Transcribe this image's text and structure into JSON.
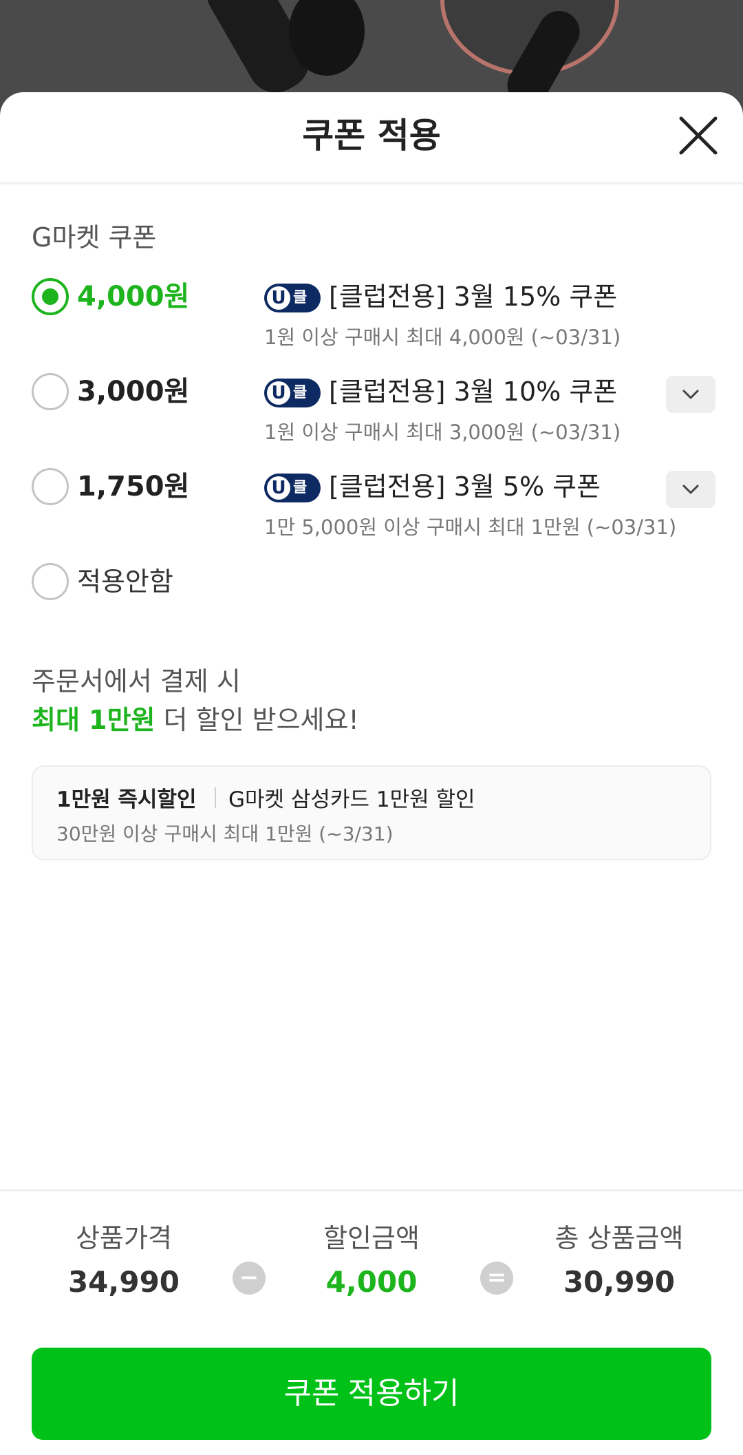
{
  "header": {
    "title": "쿠폰 적용"
  },
  "section": {
    "label": "G마켓 쿠폰"
  },
  "badge": {
    "u": "U",
    "club": "클럽"
  },
  "coupons": [
    {
      "amount": "4,000원",
      "name": "[클럽전용] 3월 15% 쿠폰",
      "condition": "1원 이상 구매시 최대 4,000원 (~03/31)",
      "selected": true
    },
    {
      "amount": "3,000원",
      "name": "[클럽전용] 3월 10% 쿠폰",
      "condition": "1원 이상 구매시 최대 3,000원 (~03/31)",
      "selected": false
    },
    {
      "amount": "1,750원",
      "name": "[클럽전용] 3월 5% 쿠폰",
      "condition": "1만 5,000원 이상 구매시 최대 1만원 (~03/31)",
      "selected": false
    }
  ],
  "no_apply": {
    "label": "적용안함"
  },
  "promo": {
    "line1": "주문서에서 결제 시",
    "highlight": "최대 1만원",
    "line2_rest": " 더 할인 받으세요!"
  },
  "card_offer": {
    "title": "1만원 즉시할인",
    "description": "G마켓 삼성카드 1만원 할인",
    "condition": "30만원 이상 구매시 최대 1만원 (~3/31)"
  },
  "summary": {
    "price_label": "상품가격",
    "price_value": "34,990",
    "minus": "−",
    "discount_label": "할인금액",
    "discount_value": "4,000",
    "equals": "=",
    "total_label": "총 상품금액",
    "total_value": "30,990"
  },
  "apply_button": {
    "label": "쿠폰 적용하기"
  },
  "colors": {
    "accent": "#1db41d",
    "button": "#00c118",
    "badge": "#0d2a63"
  }
}
